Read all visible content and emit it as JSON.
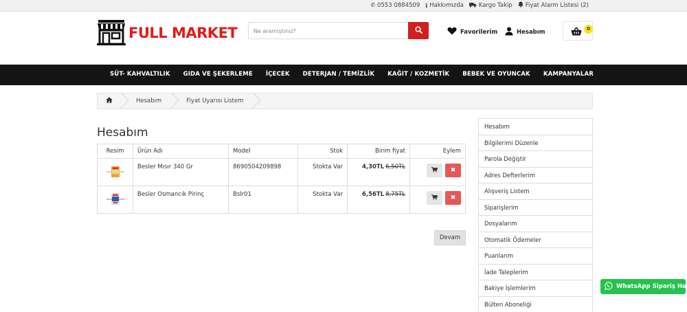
{
  "topbar": {
    "phone": "0553 0884509",
    "about": "Hakkımızda",
    "tracking": "Kargo Takip",
    "price_alarm": "Fiyat Alarm Listesi (2)"
  },
  "logo": {
    "text": "FULL MARKET"
  },
  "search": {
    "placeholder": "Ne aramıştınız?",
    "value": ""
  },
  "header": {
    "favorites": "Favorilerim",
    "account": "Hesabım",
    "cart_count": "0"
  },
  "nav": [
    "SÜT- KAHVALTILIK",
    "GIDA VE ŞEKERLEME",
    "İÇECEK",
    "DETERJAN / TEMİZLİK",
    "KAĞIT / KOZMETİK",
    "BEBEK VE OYUNCAK",
    "KAMPANYALAR"
  ],
  "breadcrumb": [
    "Hesabım",
    "Fiyat Uyarısı Listem"
  ],
  "page_title": "Hesabım",
  "table": {
    "headers": [
      "Resim",
      "Ürün Adı",
      "Model",
      "Stok",
      "Birim fiyat",
      "Eylem"
    ],
    "rows": [
      {
        "name": "Besler Mısır 340 Gr",
        "model": "8690504209898",
        "stock": "Stokta Var",
        "price": "4,30TL",
        "old_price": "6,50TL"
      },
      {
        "name": "Besler Osmancık Pirinç",
        "model": "Bslr01",
        "stock": "Stokta Var",
        "price": "6,56TL",
        "old_price": "8,75TL"
      }
    ]
  },
  "continue_label": "Devam",
  "sidebar": [
    "Hesabım",
    "Bilgilerimi Düzenle",
    "Parola Değiştir",
    "Adres Defterlerim",
    "Alışveriş Listem",
    "Siparişlerim",
    "Dosyalarım",
    "Otomatik Ödemeler",
    "Puanlarım",
    "İade Taleplerim",
    "Bakiye İşlemlerim",
    "Bülten Aboneliği"
  ],
  "whatsapp_label": "WhatsApp Sipariş Hattı",
  "colors": {
    "brand_red": "#e21b1b",
    "nav_bg": "#141414",
    "delete_red": "#e65757",
    "whatsapp_green": "#25c24e",
    "badge_yellow": "#f6e61a"
  }
}
